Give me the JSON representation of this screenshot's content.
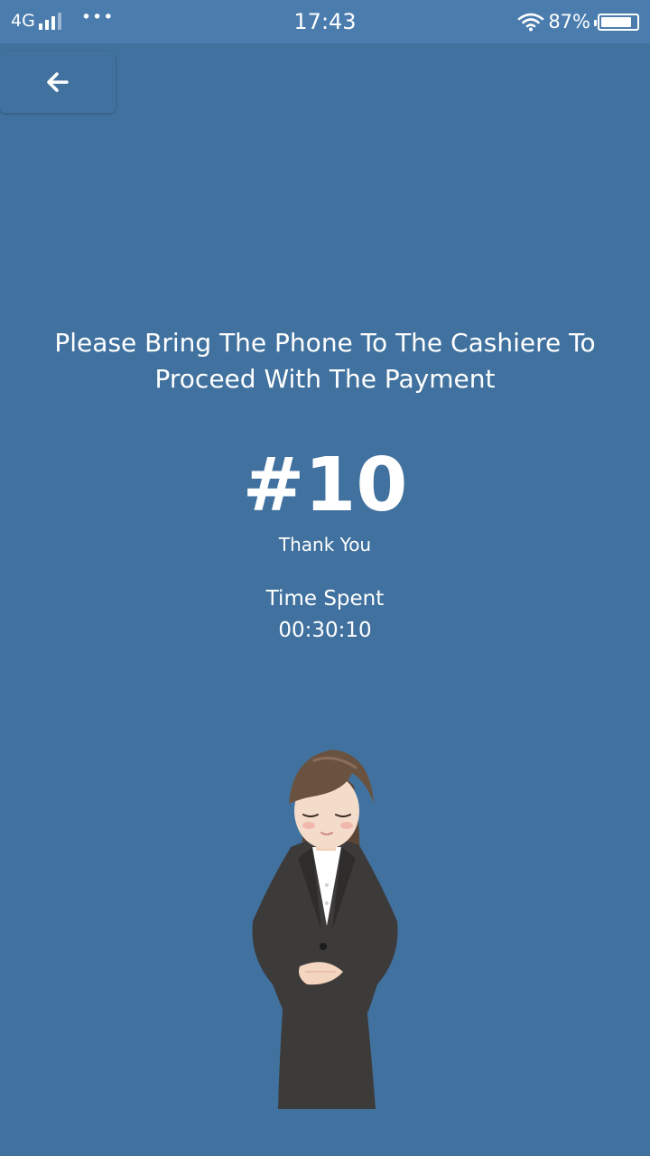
{
  "status_bar": {
    "network": "4G",
    "time": "17:43",
    "battery": "87%",
    "battery_level": 0.87,
    "signal_icon": "signal-bars-icon",
    "more_icon": "more-dots-icon",
    "wifi_icon": "wifi-icon"
  },
  "header": {
    "back_icon": "arrow-left-icon"
  },
  "main": {
    "message": "Please Bring The Phone To The Cashiere To Proceed With The Payment",
    "queue_number": "#10",
    "thanks": "Thank You",
    "time_label": "Time Spent",
    "time_value": "00:30:10"
  },
  "colors": {
    "background": "#41729f",
    "status_bar": "#4a7cae",
    "text": "#ffffff"
  }
}
